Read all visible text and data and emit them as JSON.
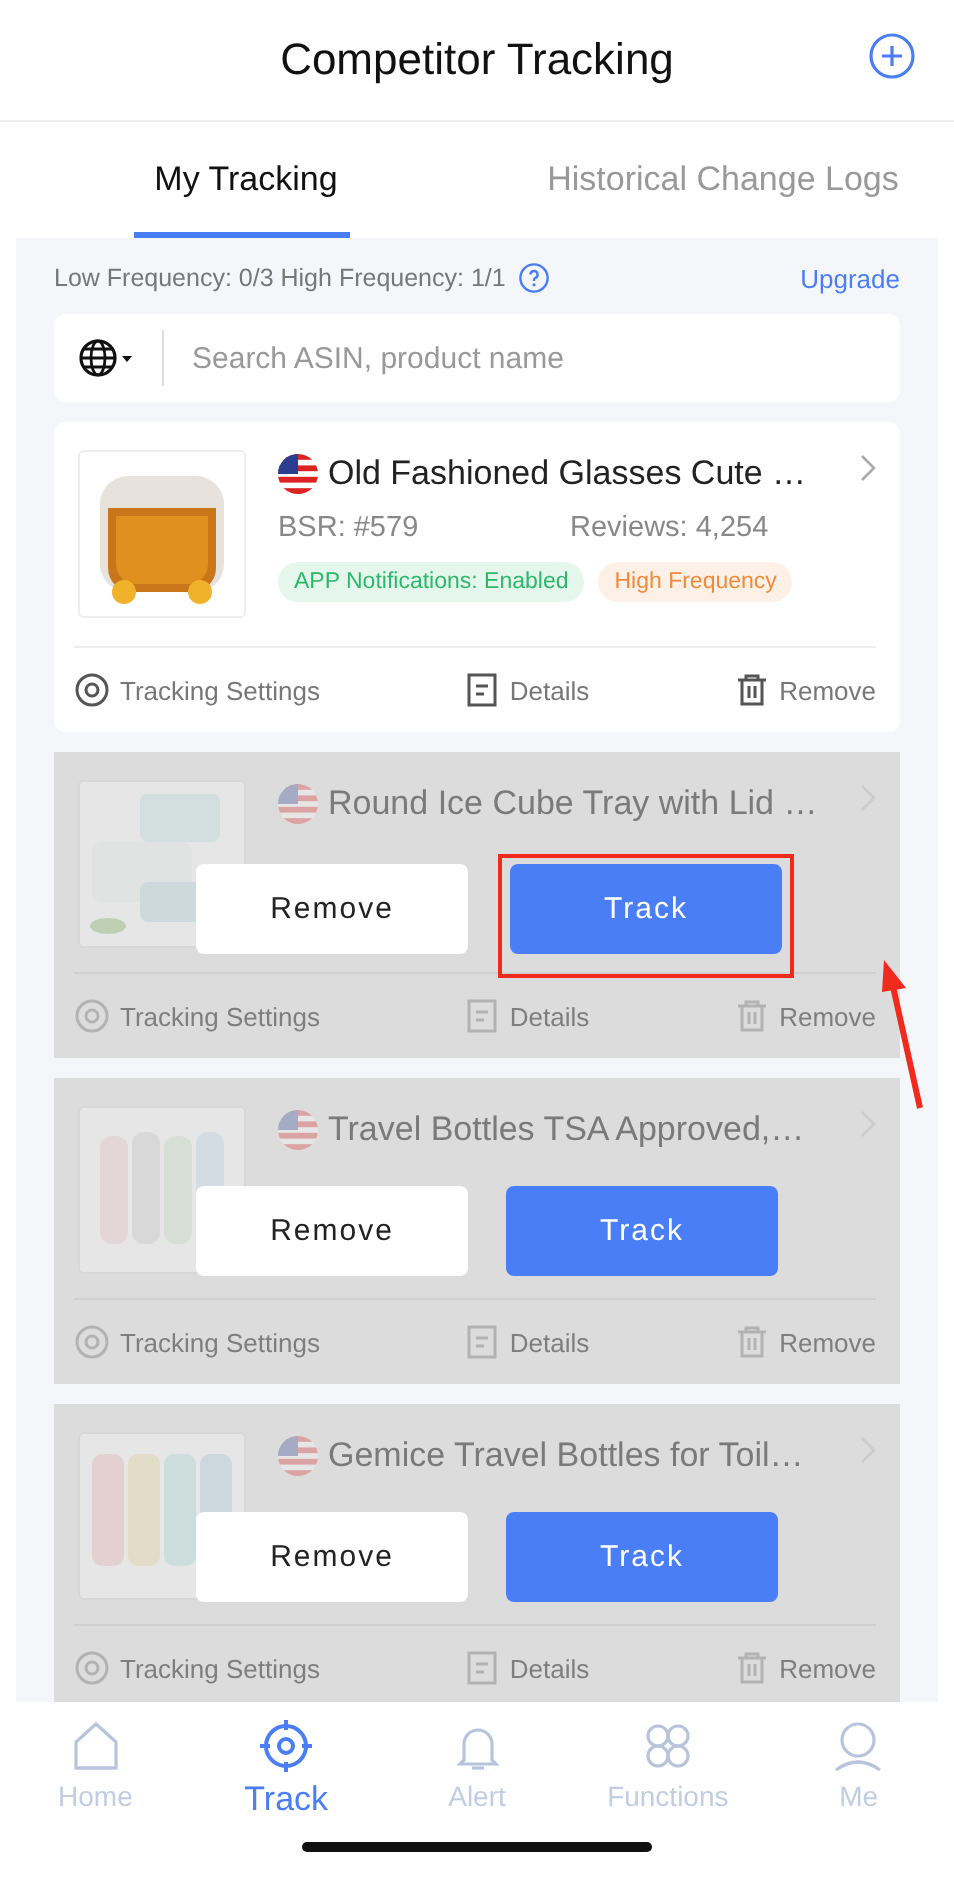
{
  "header": {
    "title": "Competitor Tracking"
  },
  "tabs": [
    {
      "label": "My Tracking",
      "selected": true
    },
    {
      "label": "Historical Change Logs",
      "selected": false
    }
  ],
  "quota": {
    "text": "Low Frequency: 0/3 High Frequency: 1/1",
    "link": "Upgrade"
  },
  "search": {
    "placeholder": "Search ASIN, product name"
  },
  "products": [
    {
      "kind": "active",
      "title": "Old Fashioned Glasses Cute …",
      "bsr": "BSR: #579",
      "reviews": "Reviews: 4,254",
      "tags": [
        {
          "label": "APP Notifications: Enabled",
          "color": "#2cb86a"
        },
        {
          "label": "High Frequency",
          "color": "#f08a3c"
        }
      ],
      "actions": [
        "Tracking Settings",
        "Details",
        "Remove"
      ]
    },
    {
      "kind": "paused",
      "title": "Round Ice Cube Tray with Lid …",
      "actions": [
        "Tracking Settings",
        "Details",
        "Remove"
      ],
      "buttons": [
        "Remove",
        "Track"
      ],
      "highlighted": true
    },
    {
      "kind": "paused",
      "title": "Travel Bottles TSA Approved,…",
      "actions": [
        "Tracking Settings",
        "Details",
        "Remove"
      ],
      "buttons": [
        "Remove",
        "Track"
      ],
      "highlighted": false
    },
    {
      "kind": "paused",
      "title": "Gemice Travel Bottles for Toil…",
      "actions": [
        "Tracking Settings",
        "Details",
        "Remove"
      ],
      "buttons": [
        "Remove",
        "Track"
      ],
      "highlighted": false
    }
  ],
  "nav": [
    {
      "label": "Home",
      "selected": false
    },
    {
      "label": "Track",
      "selected": true
    },
    {
      "label": "Alert",
      "selected": false
    },
    {
      "label": "Functions",
      "selected": false
    },
    {
      "label": "Me",
      "selected": false
    }
  ]
}
